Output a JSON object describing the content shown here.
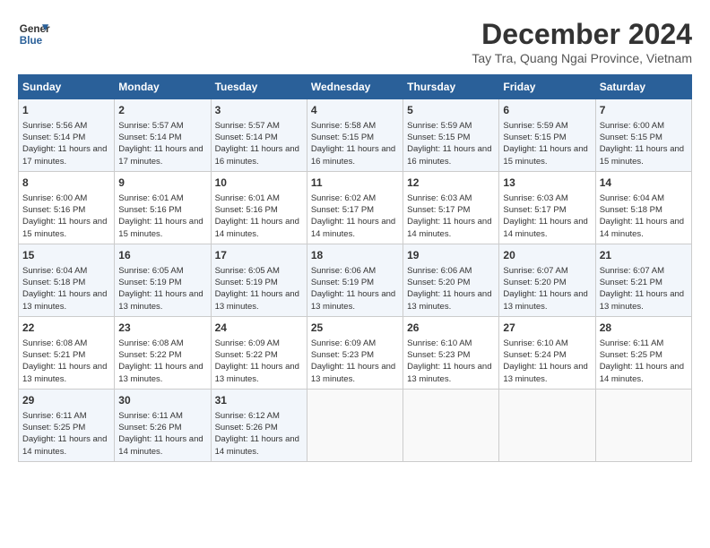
{
  "header": {
    "logo_line1": "General",
    "logo_line2": "Blue",
    "month": "December 2024",
    "location": "Tay Tra, Quang Ngai Province, Vietnam"
  },
  "days_of_week": [
    "Sunday",
    "Monday",
    "Tuesday",
    "Wednesday",
    "Thursday",
    "Friday",
    "Saturday"
  ],
  "weeks": [
    [
      {
        "day": 1,
        "info": "Sunrise: 5:56 AM\nSunset: 5:14 PM\nDaylight: 11 hours and 17 minutes."
      },
      {
        "day": 2,
        "info": "Sunrise: 5:57 AM\nSunset: 5:14 PM\nDaylight: 11 hours and 17 minutes."
      },
      {
        "day": 3,
        "info": "Sunrise: 5:57 AM\nSunset: 5:14 PM\nDaylight: 11 hours and 16 minutes."
      },
      {
        "day": 4,
        "info": "Sunrise: 5:58 AM\nSunset: 5:15 PM\nDaylight: 11 hours and 16 minutes."
      },
      {
        "day": 5,
        "info": "Sunrise: 5:59 AM\nSunset: 5:15 PM\nDaylight: 11 hours and 16 minutes."
      },
      {
        "day": 6,
        "info": "Sunrise: 5:59 AM\nSunset: 5:15 PM\nDaylight: 11 hours and 15 minutes."
      },
      {
        "day": 7,
        "info": "Sunrise: 6:00 AM\nSunset: 5:15 PM\nDaylight: 11 hours and 15 minutes."
      }
    ],
    [
      {
        "day": 8,
        "info": "Sunrise: 6:00 AM\nSunset: 5:16 PM\nDaylight: 11 hours and 15 minutes."
      },
      {
        "day": 9,
        "info": "Sunrise: 6:01 AM\nSunset: 5:16 PM\nDaylight: 11 hours and 15 minutes."
      },
      {
        "day": 10,
        "info": "Sunrise: 6:01 AM\nSunset: 5:16 PM\nDaylight: 11 hours and 14 minutes."
      },
      {
        "day": 11,
        "info": "Sunrise: 6:02 AM\nSunset: 5:17 PM\nDaylight: 11 hours and 14 minutes."
      },
      {
        "day": 12,
        "info": "Sunrise: 6:03 AM\nSunset: 5:17 PM\nDaylight: 11 hours and 14 minutes."
      },
      {
        "day": 13,
        "info": "Sunrise: 6:03 AM\nSunset: 5:17 PM\nDaylight: 11 hours and 14 minutes."
      },
      {
        "day": 14,
        "info": "Sunrise: 6:04 AM\nSunset: 5:18 PM\nDaylight: 11 hours and 14 minutes."
      }
    ],
    [
      {
        "day": 15,
        "info": "Sunrise: 6:04 AM\nSunset: 5:18 PM\nDaylight: 11 hours and 13 minutes."
      },
      {
        "day": 16,
        "info": "Sunrise: 6:05 AM\nSunset: 5:19 PM\nDaylight: 11 hours and 13 minutes."
      },
      {
        "day": 17,
        "info": "Sunrise: 6:05 AM\nSunset: 5:19 PM\nDaylight: 11 hours and 13 minutes."
      },
      {
        "day": 18,
        "info": "Sunrise: 6:06 AM\nSunset: 5:19 PM\nDaylight: 11 hours and 13 minutes."
      },
      {
        "day": 19,
        "info": "Sunrise: 6:06 AM\nSunset: 5:20 PM\nDaylight: 11 hours and 13 minutes."
      },
      {
        "day": 20,
        "info": "Sunrise: 6:07 AM\nSunset: 5:20 PM\nDaylight: 11 hours and 13 minutes."
      },
      {
        "day": 21,
        "info": "Sunrise: 6:07 AM\nSunset: 5:21 PM\nDaylight: 11 hours and 13 minutes."
      }
    ],
    [
      {
        "day": 22,
        "info": "Sunrise: 6:08 AM\nSunset: 5:21 PM\nDaylight: 11 hours and 13 minutes."
      },
      {
        "day": 23,
        "info": "Sunrise: 6:08 AM\nSunset: 5:22 PM\nDaylight: 11 hours and 13 minutes."
      },
      {
        "day": 24,
        "info": "Sunrise: 6:09 AM\nSunset: 5:22 PM\nDaylight: 11 hours and 13 minutes."
      },
      {
        "day": 25,
        "info": "Sunrise: 6:09 AM\nSunset: 5:23 PM\nDaylight: 11 hours and 13 minutes."
      },
      {
        "day": 26,
        "info": "Sunrise: 6:10 AM\nSunset: 5:23 PM\nDaylight: 11 hours and 13 minutes."
      },
      {
        "day": 27,
        "info": "Sunrise: 6:10 AM\nSunset: 5:24 PM\nDaylight: 11 hours and 13 minutes."
      },
      {
        "day": 28,
        "info": "Sunrise: 6:11 AM\nSunset: 5:25 PM\nDaylight: 11 hours and 14 minutes."
      }
    ],
    [
      {
        "day": 29,
        "info": "Sunrise: 6:11 AM\nSunset: 5:25 PM\nDaylight: 11 hours and 14 minutes."
      },
      {
        "day": 30,
        "info": "Sunrise: 6:11 AM\nSunset: 5:26 PM\nDaylight: 11 hours and 14 minutes."
      },
      {
        "day": 31,
        "info": "Sunrise: 6:12 AM\nSunset: 5:26 PM\nDaylight: 11 hours and 14 minutes."
      },
      null,
      null,
      null,
      null
    ]
  ]
}
